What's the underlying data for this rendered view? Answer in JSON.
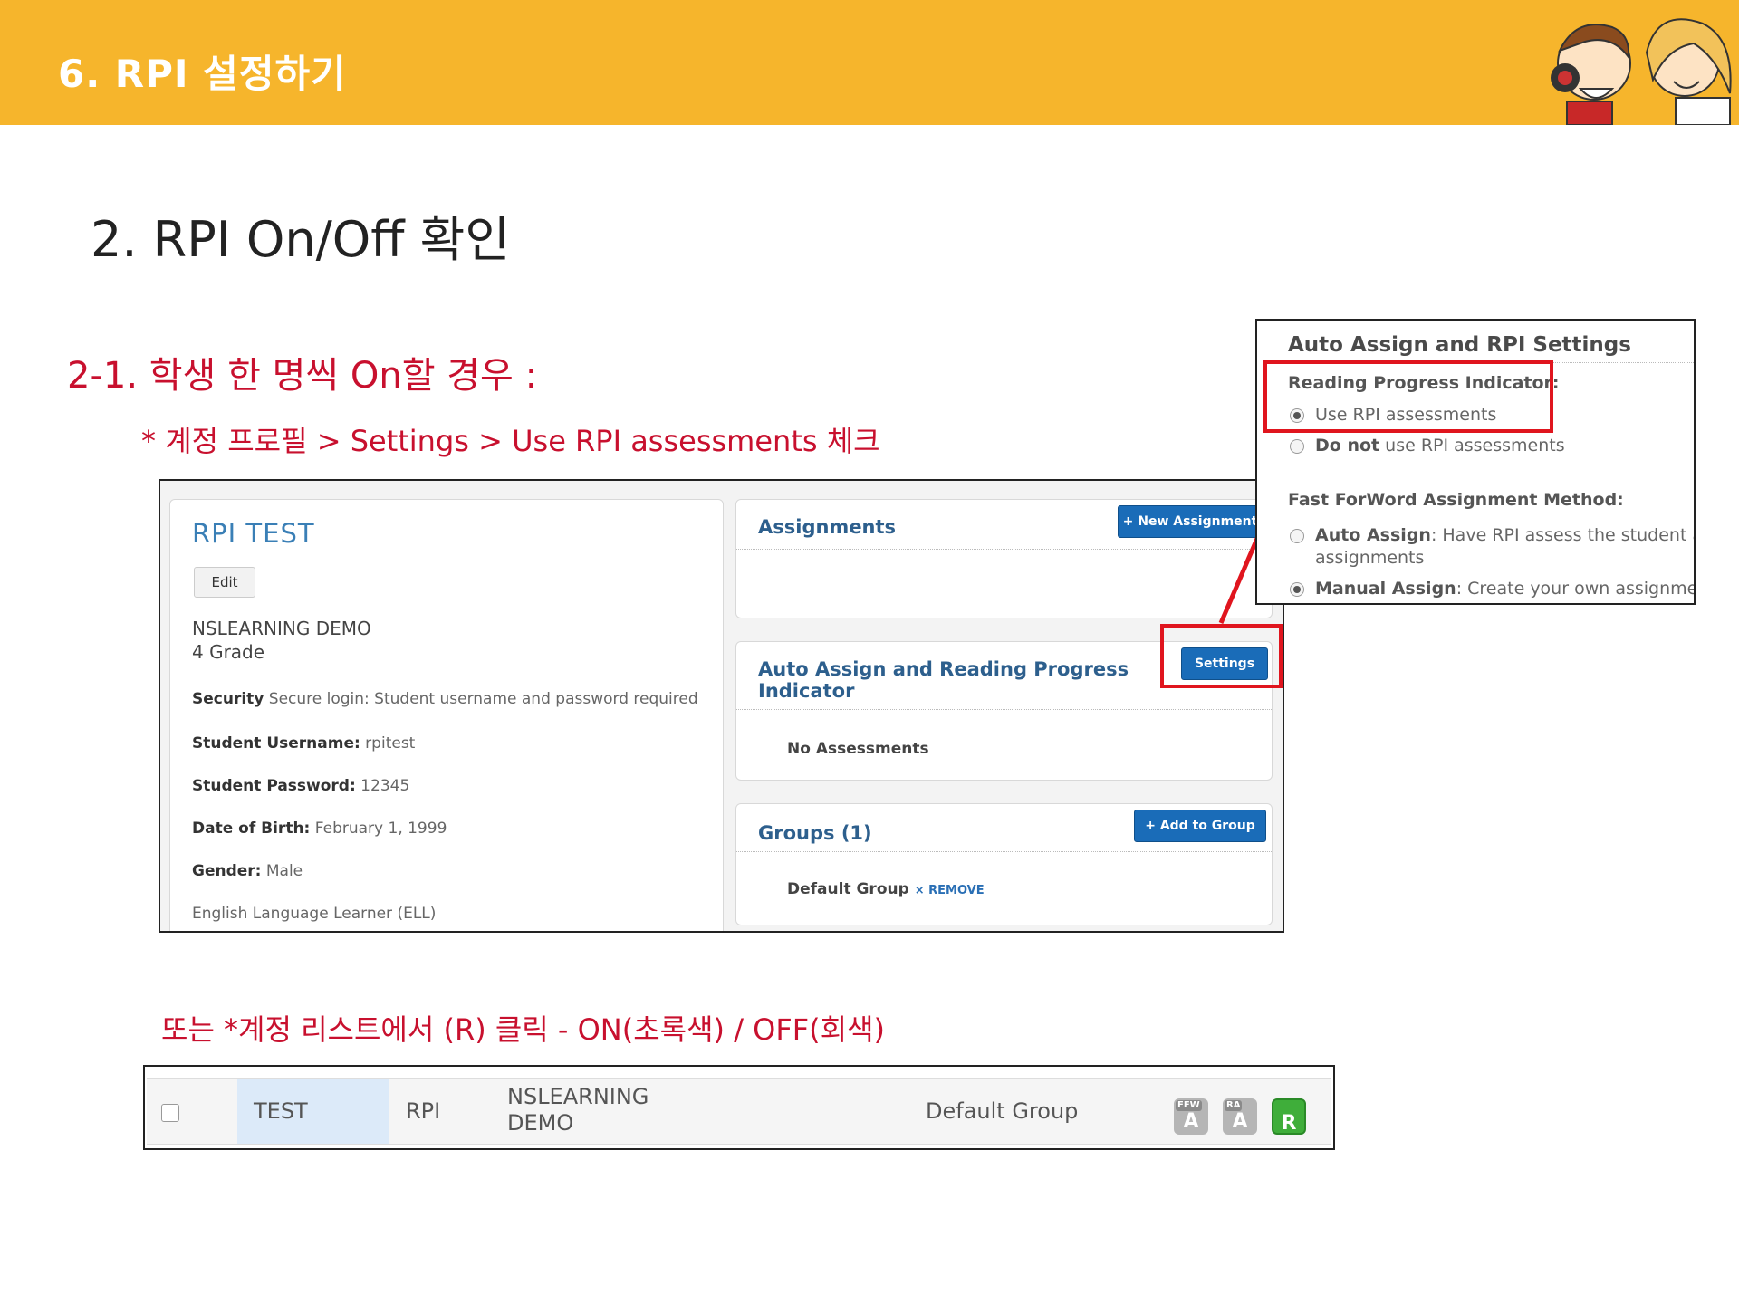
{
  "banner": {
    "title": "6. RPI 설정하기"
  },
  "heading": "2. RPI On/Off 확인",
  "section_title": "2-1. 학생 한 명씩 On할 경우 :",
  "section_sub": "* 계정 프로필 > Settings > Use RPI assessments 체크",
  "or_note": "또는 *계정 리스트에서 (R) 클릭 -  ON(초록색) / OFF(회색)",
  "student": {
    "name": "RPI  TEST",
    "edit_label": "Edit",
    "school": "NSLEARNING DEMO",
    "grade": "4 Grade",
    "security_label": "Security",
    "security_value": " Secure login: Student username and password required",
    "username_label": "Student Username:",
    "username_value": " rpitest",
    "password_label": "Student Password:",
    "password_value": " 12345",
    "dob_label": "Date of Birth:",
    "dob_value": " February 1, 1999",
    "gender_label": "Gender:",
    "gender_value": " Male",
    "ell": "English Language Learner (ELL)"
  },
  "assignments": {
    "title": "Assignments",
    "button": "+ New Assignment"
  },
  "auto_assign": {
    "title_line1": "Auto Assign and Reading Progress",
    "title_line2": "Indicator",
    "button": "Settings",
    "body": "No Assessments"
  },
  "groups": {
    "title": "Groups (1)",
    "button": "+ Add to Group",
    "item": "Default Group",
    "remove": "× REMOVE"
  },
  "popup": {
    "title": "Auto Assign and RPI Settings",
    "rpi_heading": "Reading Progress Indicator:",
    "opt_use": "Use RPI assessments",
    "opt_not_bold": "Do not",
    "opt_not_rest": " use RPI assessments",
    "method_heading": "Fast ForWord Assignment Method:",
    "auto_bold": "Auto Assign",
    "auto_rest": ": Have RPI assess the student ar",
    "auto_rest2": "assignments",
    "manual_bold": "Manual Assign",
    "manual_rest": ": Create your own assignments"
  },
  "list_row": {
    "first": "TEST",
    "last": "RPI",
    "school_line1": "NSLEARNING",
    "school_line2": "DEMO",
    "group": "Default Group",
    "badges": [
      {
        "small": "FFW",
        "big": "A",
        "state": "off"
      },
      {
        "small": "RA",
        "big": "A",
        "state": "off"
      },
      {
        "small": "",
        "big": "R",
        "state": "on"
      }
    ]
  },
  "colors": {
    "banner": "#f6b52c",
    "accent_red": "#c8102e",
    "highlight_red": "#e0151e",
    "button_blue": "#1a6cb8",
    "on_green": "#3fae3a",
    "off_gray": "#b5b5b5"
  }
}
